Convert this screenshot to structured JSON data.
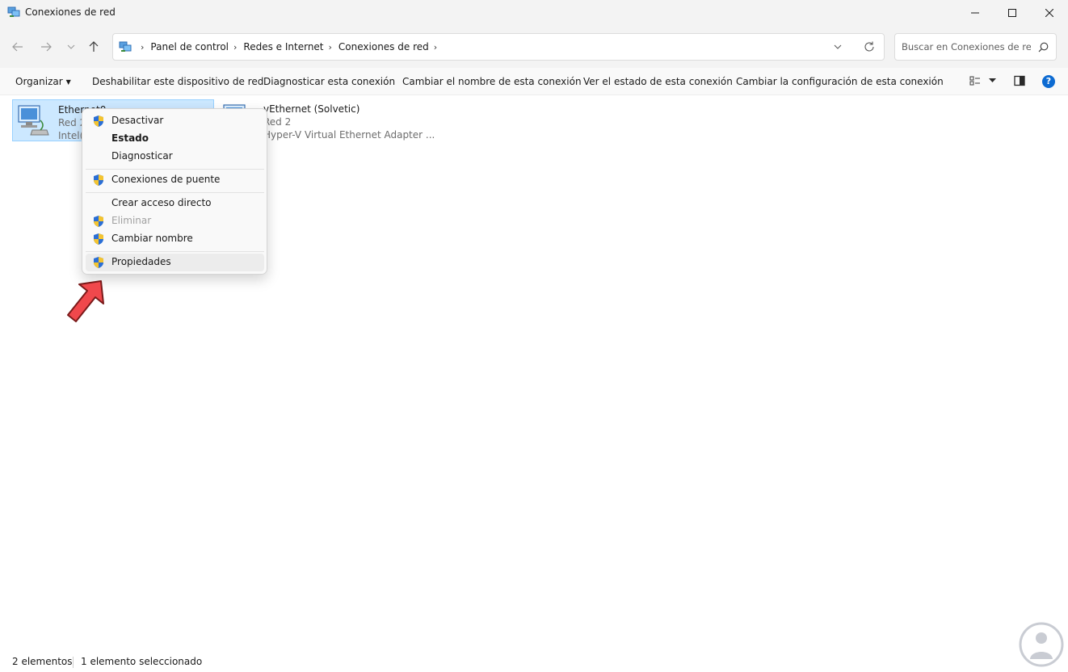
{
  "window": {
    "title": "Conexiones de red"
  },
  "address": {
    "breadcrumbs": [
      "Panel de control",
      "Redes e Internet",
      "Conexiones de red"
    ],
    "search_placeholder": "Buscar en Conexiones de red"
  },
  "toolbar": {
    "organize": "Organizar",
    "commands": [
      "Deshabilitar este dispositivo de red",
      "Diagnosticar esta conexión",
      "Cambiar el nombre de esta conexión",
      "Ver el estado de esta conexión",
      "Cambiar la configuración de esta conexión"
    ],
    "help": "?"
  },
  "connections": [
    {
      "name": "Ethernet0",
      "network": "Red 2",
      "adapter": "Intel(I",
      "selected": true
    },
    {
      "name": "vEthernet (Solvetic)",
      "network": "Red 2",
      "adapter": "Hyper-V Virtual Ethernet Adapter ...",
      "selected": false
    }
  ],
  "context_menu": {
    "items": [
      {
        "label": "Desactivar",
        "shield": true,
        "bold": false,
        "disabled": false
      },
      {
        "label": "Estado",
        "shield": false,
        "bold": true,
        "disabled": false
      },
      {
        "label": "Diagnosticar",
        "shield": false,
        "bold": false,
        "disabled": false
      },
      {
        "label": "Conexiones de puente",
        "shield": true,
        "bold": false,
        "disabled": false
      },
      {
        "label": "Crear acceso directo",
        "shield": false,
        "bold": false,
        "disabled": false
      },
      {
        "label": "Eliminar",
        "shield": true,
        "bold": false,
        "disabled": true
      },
      {
        "label": "Cambiar nombre",
        "shield": true,
        "bold": false,
        "disabled": false
      },
      {
        "label": "Propiedades",
        "shield": true,
        "bold": false,
        "disabled": false,
        "highlighted": true
      }
    ]
  },
  "status": {
    "count": "2 elementos",
    "selection": "1 elemento seleccionado"
  },
  "colors": {
    "selection_bg": "#cce8ff",
    "accent": "#0d6bd2",
    "arrow": "#f0484c"
  },
  "icons": [
    "network-connections-icon",
    "back-arrow-icon",
    "forward-arrow-icon",
    "recent-dropdown-icon",
    "up-arrow-icon",
    "chevron-right-icon",
    "refresh-icon",
    "search-icon",
    "view-options-icon",
    "preview-pane-icon",
    "help-icon",
    "network-adapter-icon",
    "uac-shield-icon",
    "red-arrow-icon"
  ]
}
